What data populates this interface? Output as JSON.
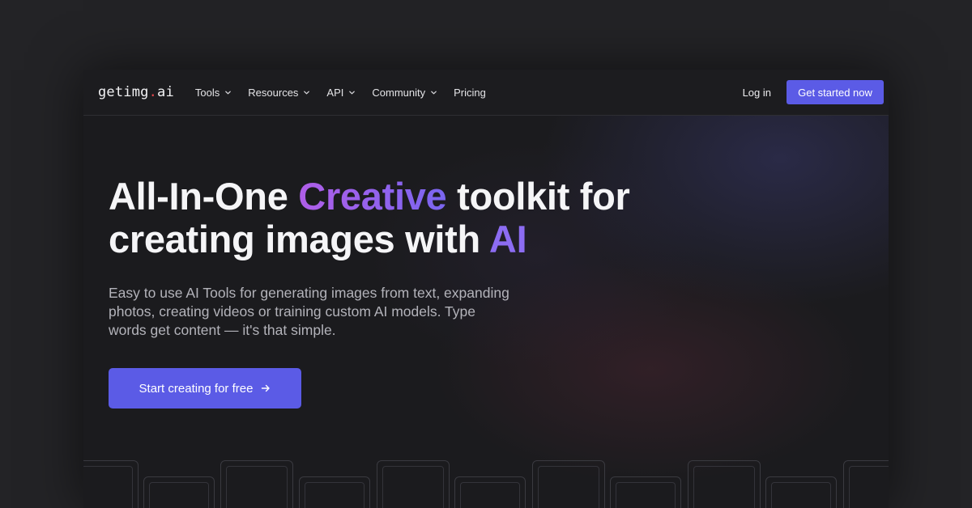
{
  "brand": {
    "logo_prefix": "getimg",
    "logo_dot": ".",
    "logo_suffix": "ai"
  },
  "nav": {
    "items": [
      {
        "label": "Tools",
        "has_dropdown": true
      },
      {
        "label": "Resources",
        "has_dropdown": true
      },
      {
        "label": "API",
        "has_dropdown": true
      },
      {
        "label": "Community",
        "has_dropdown": true
      },
      {
        "label": "Pricing",
        "has_dropdown": false
      }
    ],
    "login_label": "Log in",
    "cta_label": "Get started now"
  },
  "hero": {
    "title_part1": "All-In-One ",
    "title_highlight": "Creative",
    "title_part2": " toolkit for",
    "title_line2": "creating images with ",
    "title_ai": "AI",
    "subtitle": "Easy to use AI Tools for generating images from text, expanding photos, creating videos or training custom AI models. Type words get content — it's that simple.",
    "cta_label": "Start creating for free",
    "cta_icon": "arrow-right-icon"
  },
  "colors": {
    "accent": "#5b5be6",
    "gradient_start": "#b05ee8",
    "gradient_end": "#7a66f0",
    "logo_dot": "#e5484d",
    "background": "#1b1b1e"
  }
}
